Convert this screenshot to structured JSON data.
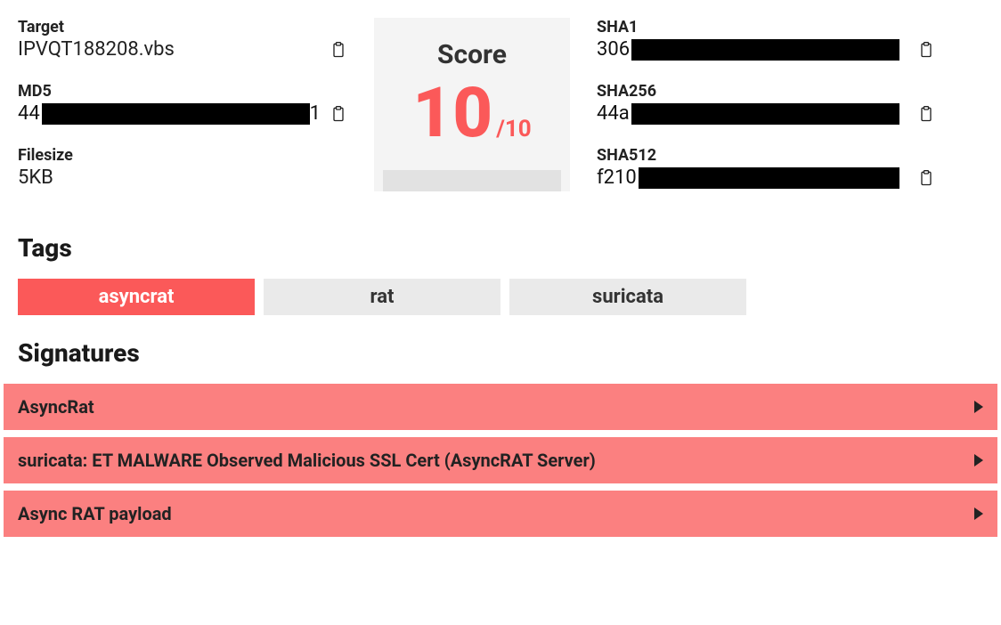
{
  "file": {
    "target_label": "Target",
    "target_value": "IPVQT188208.vbs",
    "md5_label": "MD5",
    "md5_prefix": "44",
    "md5_suffix": "1",
    "filesize_label": "Filesize",
    "filesize_value": "5KB",
    "sha1_label": "SHA1",
    "sha1_prefix": "306",
    "sha256_label": "SHA256",
    "sha256_prefix": "44a",
    "sha512_label": "SHA512",
    "sha512_prefix": "f210"
  },
  "score": {
    "title": "Score",
    "value": "10",
    "outof": "/10"
  },
  "sections": {
    "tags_title": "Tags",
    "signatures_title": "Signatures"
  },
  "tags": [
    {
      "label": "asyncrat",
      "active": true
    },
    {
      "label": "rat",
      "active": false
    },
    {
      "label": "suricata",
      "active": false
    }
  ],
  "signatures": [
    {
      "label": "AsyncRat"
    },
    {
      "label": "suricata: ET MALWARE Observed Malicious SSL Cert (AsyncRAT Server)"
    },
    {
      "label": "Async RAT payload"
    }
  ]
}
